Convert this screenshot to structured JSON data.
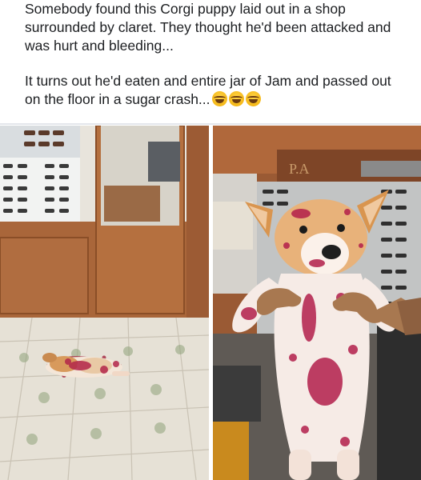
{
  "post": {
    "text_line1": "Somebody found this Corgi puppy laid out in a shop surrounded by claret. They thought he'd been attacked and was hurt and bleeding...",
    "text_line2": "It turns out he'd eaten and entire jar of Jam and passed out on the floor in a sugar crash...",
    "emojis": [
      "laughing-tears-emoji",
      "laughing-tears-emoji",
      "laughing-tears-emoji"
    ]
  },
  "photos": [
    {
      "icon": "corgi-on-floor-photo",
      "sign_text": ""
    },
    {
      "icon": "corgi-held-up-photo",
      "sign_text": "P.A"
    }
  ]
}
